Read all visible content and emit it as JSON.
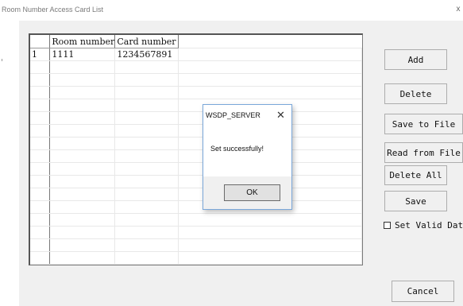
{
  "window": {
    "title": "Room Number Access Card List",
    "close_glyph": "x"
  },
  "grid": {
    "columns": [
      "Room number",
      "Card number"
    ],
    "rows": [
      {
        "index": "1",
        "room": "1111",
        "card": "1234567891"
      }
    ]
  },
  "buttons": {
    "add": "Add",
    "delete": "Delete",
    "save_to_file": "Save to File",
    "read_from_file": "Read from File",
    "delete_all": "Delete All",
    "save": "Save",
    "cancel": "Cancel"
  },
  "checkbox": {
    "label": "Set Valid Dat",
    "checked": false
  },
  "dialog": {
    "title": "WSDP_SERVER",
    "close_glyph": "✕",
    "message": "Set successfully!",
    "ok_label": "OK"
  }
}
